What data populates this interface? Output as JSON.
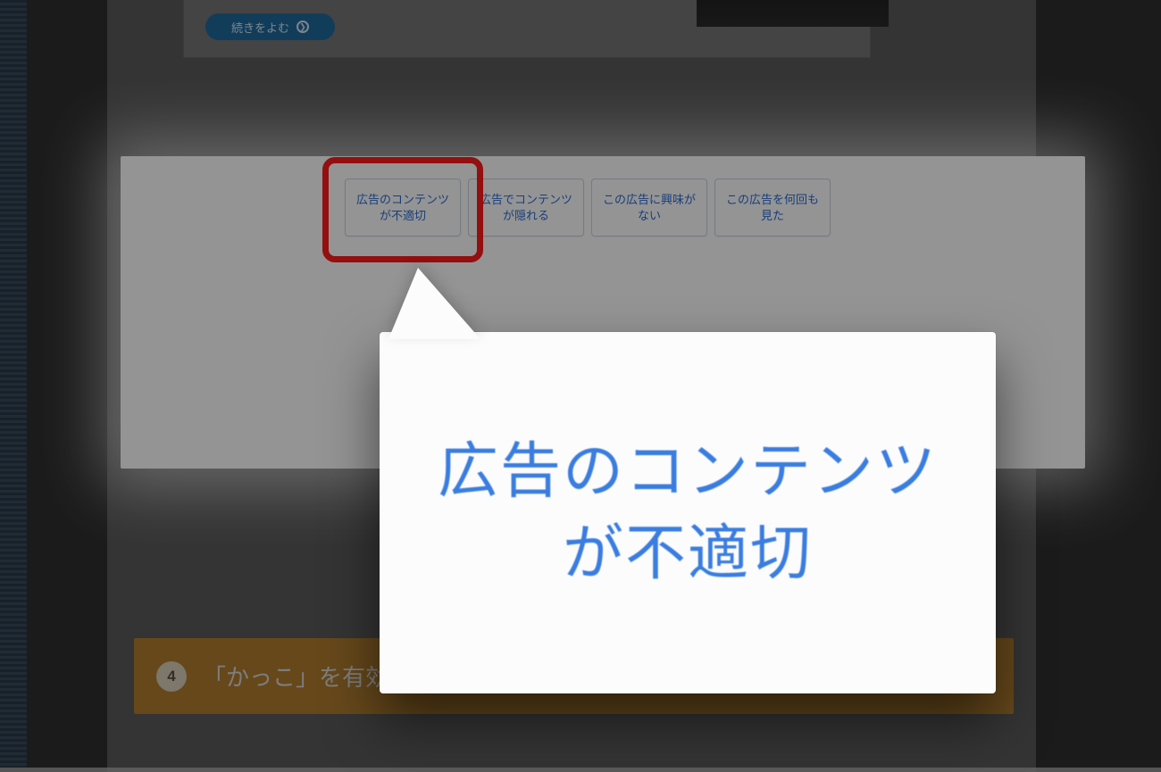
{
  "article": {
    "readmore_label": "続きをよむ"
  },
  "ad_feedback": {
    "options": [
      "広告のコンテンツが不適切",
      "広告でコンテンツが隠れる",
      "この広告に興味がない",
      "この広告を何回も見た"
    ],
    "highlighted_index": 0
  },
  "callout": {
    "text": "広告のコンテンツが不適切"
  },
  "section": {
    "number": "4",
    "title": "「かっこ」を有効に使う"
  }
}
